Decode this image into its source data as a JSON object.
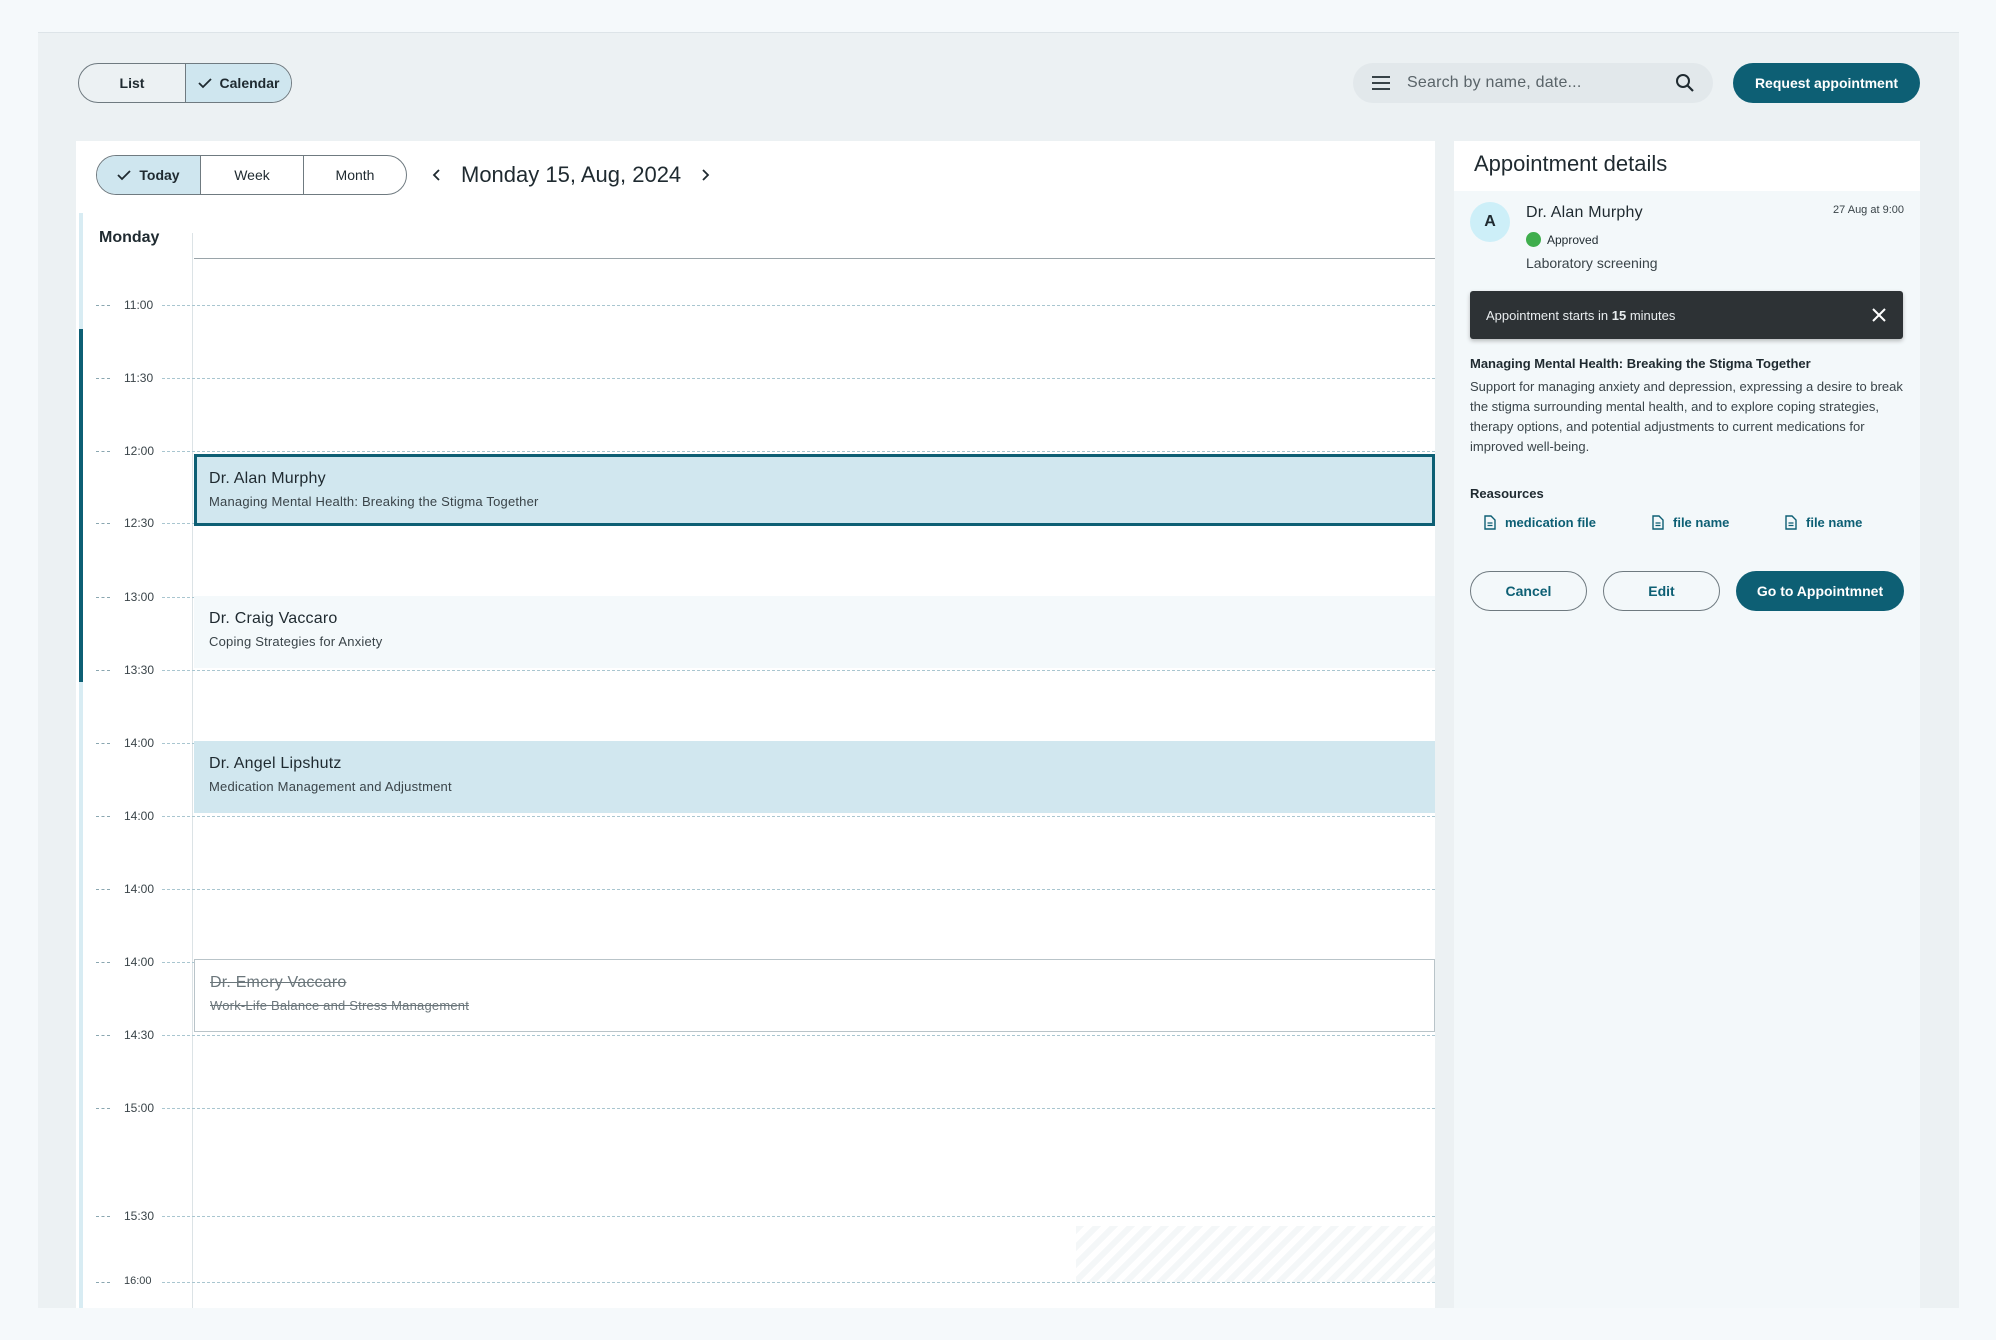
{
  "top_bar": {
    "view_toggle": [
      {
        "label": "List",
        "selected": false
      },
      {
        "label": "Calendar",
        "selected": true
      }
    ],
    "search_placeholder": "Search by name, date...",
    "request_button": "Request appointment"
  },
  "calendar": {
    "range_toggle": [
      {
        "label": "Today",
        "selected": true
      },
      {
        "label": "Week",
        "selected": false
      },
      {
        "label": "Month",
        "selected": false
      }
    ],
    "current_date": "Monday 15, Aug, 2024",
    "day_label": "Monday",
    "time_slots": [
      "11:00",
      "11:30",
      "12:00",
      "12:30",
      "13:00",
      "13:30",
      "14:00",
      "14:00",
      "14:00",
      "14:00",
      "14:30",
      "15:00",
      "15:30",
      "16:00"
    ],
    "events": [
      {
        "doctor": "Dr. Alan Murphy",
        "title": "Managing Mental Health: Breaking the Stigma Together",
        "state": "selected"
      },
      {
        "doctor": "Dr. Craig Vaccaro",
        "title": "Coping Strategies for Anxiety",
        "state": "default"
      },
      {
        "doctor": "Dr. Angel Lipshutz",
        "title": "Medication Management and Adjustment",
        "state": "highlighted"
      },
      {
        "doctor": "Dr. Emery Vaccaro",
        "title": "Work-Life Balance and Stress Management",
        "state": "cancelled"
      }
    ]
  },
  "details": {
    "heading": "Appointment details",
    "avatar_initial": "A",
    "doctor": "Dr. Alan Murphy",
    "status": "Approved",
    "status_color": "#3fae4d",
    "type": "Laboratory screening",
    "datetime": "27 Aug at 9:00",
    "notice": {
      "prefix": "Appointment starts in ",
      "value": "15",
      "suffix": " minutes"
    },
    "topic_title": "Managing Mental Health: Breaking the Stigma Together",
    "topic_body": "Support for managing anxiety and depression, expressing a desire to break the stigma surrounding mental health, and to explore coping strategies, therapy options, and potential adjustments to current medications for improved well-being.",
    "resources_label": "Reasources",
    "resources": [
      {
        "label": "medication file",
        "icon": "document-icon"
      },
      {
        "label": "file name",
        "icon": "document-icon"
      },
      {
        "label": "file name",
        "icon": "document-icon"
      }
    ],
    "actions": {
      "cancel": "Cancel",
      "edit": "Edit",
      "go": "Go to Appointmnet"
    }
  },
  "colors": {
    "primary": "#0d5f74",
    "selected_fill": "#d1e7ef",
    "page_bg": "#ecf1f3"
  }
}
